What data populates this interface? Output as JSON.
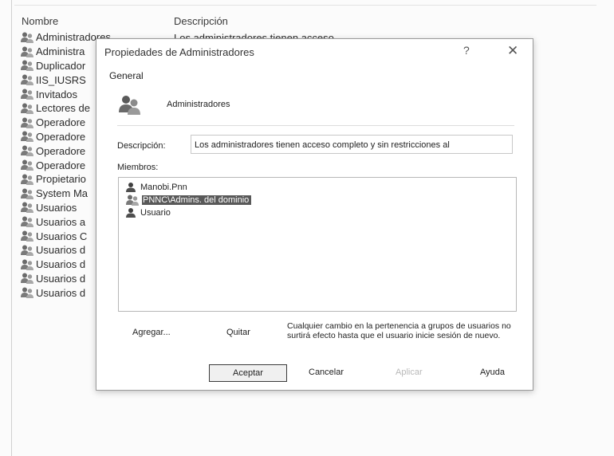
{
  "list": {
    "header_name": "Nombre",
    "header_description": "Descripción",
    "first_description": "Los administradores tienen acceso",
    "groups": [
      "Administradores",
      "Administra",
      "Duplicador",
      "IIS_IUSRS",
      "Invitados",
      "Lectores de",
      "Operadore",
      "Operadore",
      "Operadore",
      "Operadore",
      "Propietario",
      "System Ma",
      "Usuarios",
      "Usuarios a",
      "Usuarios C",
      "Usuarios d",
      "Usuarios d",
      "Usuarios d",
      "Usuarios d"
    ]
  },
  "dialog": {
    "title": "Propiedades de Administradores",
    "help_glyph": "?",
    "close_glyph": "✕",
    "tab_label": "General",
    "group_name": "Administradores",
    "description_label": "Descripción:",
    "description_value": "Los administradores tienen acceso completo y sin restricciones al",
    "members_label": "Miembros:",
    "members": [
      {
        "name": "Manobi.Pnn",
        "icon": "user-icon",
        "selected": false
      },
      {
        "name": "PNNC\\Admins. del dominio",
        "icon": "group-icon",
        "selected": true
      },
      {
        "name": "Usuario",
        "icon": "user-icon",
        "selected": false
      }
    ],
    "add_label": "Agregar...",
    "remove_label": "Quitar",
    "info_text": "Cualquier cambio en la pertenencia a grupos de usuarios no surtirá efecto hasta que el usuario inicie sesión de nuevo.",
    "accept_label": "Aceptar",
    "cancel_label": "Cancelar",
    "apply_label": "Aplicar",
    "help_label": "Ayuda"
  },
  "colors": {
    "selection_bg": "#595959",
    "disabled_text": "#b9b9b9"
  }
}
